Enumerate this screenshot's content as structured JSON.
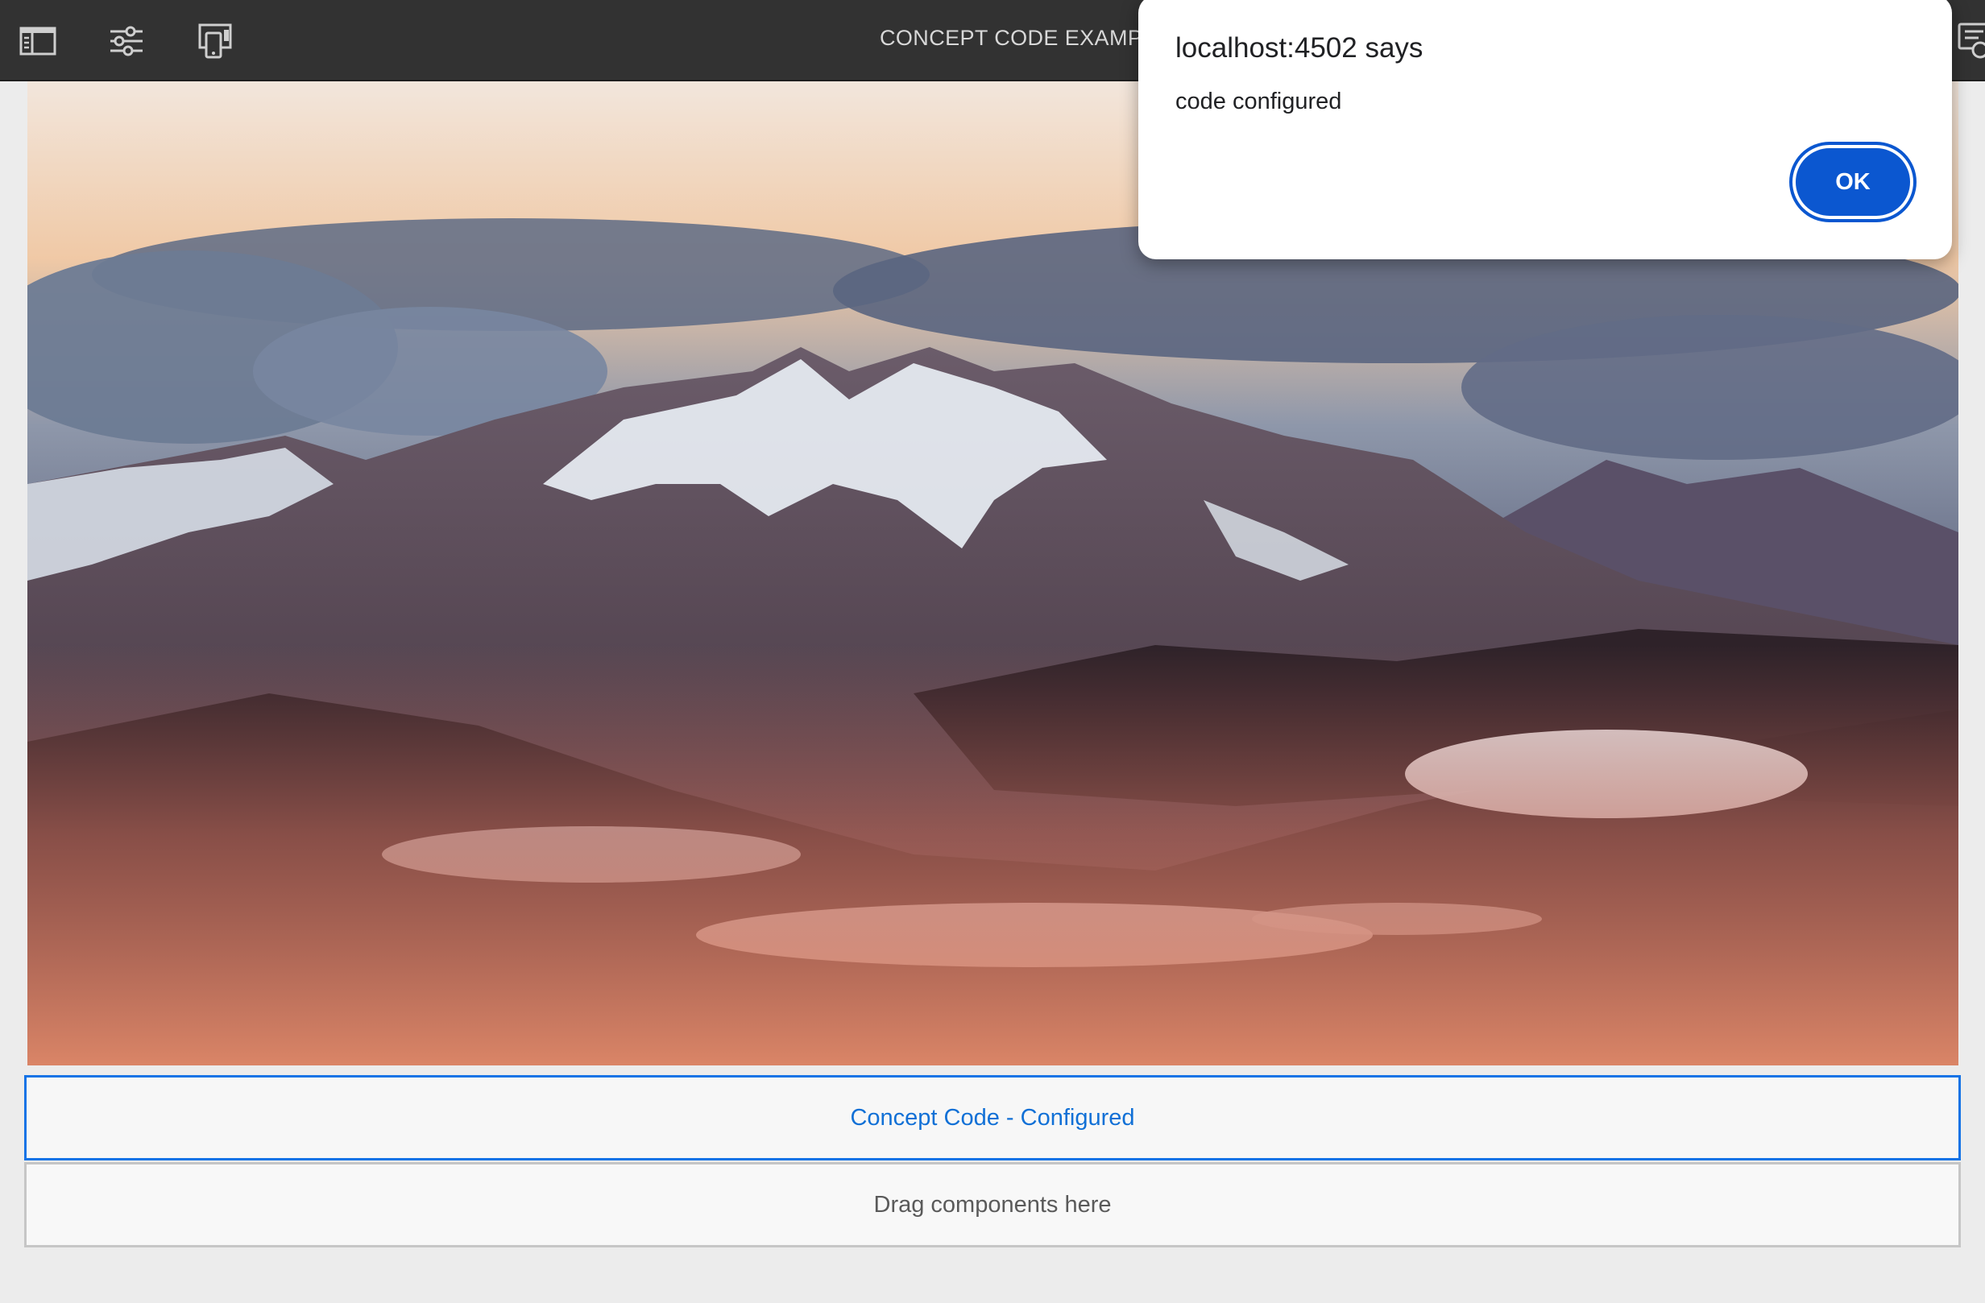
{
  "toolbar": {
    "page_title": "CONCEPT CODE EXAMPLE",
    "buttons": [
      {
        "name": "toggle-side-panel",
        "icon": "side-panel-icon"
      },
      {
        "name": "page-properties",
        "icon": "sliders-icon"
      },
      {
        "name": "emulator",
        "icon": "device-emulator-icon"
      }
    ],
    "right_icon": "annotations-icon"
  },
  "page": {
    "hero_image": "mountain-landscape-image",
    "components": {
      "configured_label": "Concept Code - Configured",
      "drop_zone_label": "Drag components here"
    }
  },
  "dialog": {
    "title": "localhost:4502 says",
    "message": "code configured",
    "ok_label": "OK"
  },
  "colors": {
    "toolbar_bg": "#323232",
    "accent_blue": "#1473e6",
    "dialog_button": "#0b57d0",
    "canvas_bg": "#ececec"
  }
}
